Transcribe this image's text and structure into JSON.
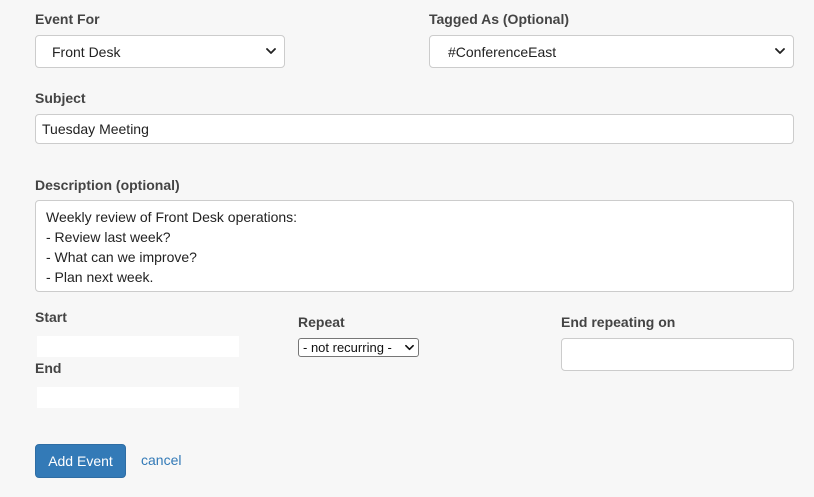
{
  "event_for": {
    "label": "Event For",
    "selected": "Front Desk"
  },
  "tagged_as": {
    "label": "Tagged As (Optional)",
    "selected": "#ConferenceEast"
  },
  "subject": {
    "label": "Subject",
    "value": "Tuesday Meeting"
  },
  "description": {
    "label": "Description (optional)",
    "lines": [
      "Weekly review of Front Desk operations:",
      "- Review last week?",
      "- What can we improve?",
      "- Plan next week."
    ]
  },
  "start": {
    "label": "Start",
    "value": ""
  },
  "end": {
    "label": "End",
    "value": ""
  },
  "repeat": {
    "label": "Repeat",
    "selected": "- not recurring -"
  },
  "end_repeating": {
    "label": "End repeating on",
    "value": ""
  },
  "actions": {
    "submit_label": "Add Event",
    "cancel_label": "cancel"
  },
  "colors": {
    "primary": "#337ab7",
    "background": "#f7f7f7",
    "border": "#cccccc"
  }
}
